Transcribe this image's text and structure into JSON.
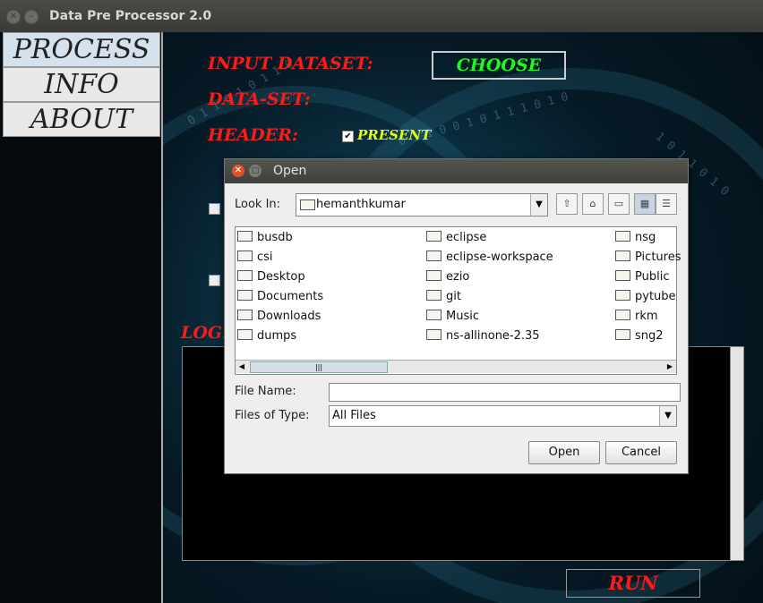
{
  "window": {
    "title": "Data Pre Processor 2.0"
  },
  "tabs": [
    {
      "label": "PROCESS"
    },
    {
      "label": "INFO"
    },
    {
      "label": "ABOUT"
    }
  ],
  "form": {
    "input_dataset_label": "INPUT DATASET:",
    "choose_label": "CHOOSE",
    "dataset_label": "DATA-SET:",
    "header_label": "HEADER:",
    "present_label": "PRESENT",
    "present_checked": true,
    "log_label": "LOG.",
    "run_label": "RUN"
  },
  "dialog": {
    "title": "Open",
    "look_in_label": "Look In:",
    "look_in_value": "hemanthkumar",
    "files": [
      "busdb",
      "csi",
      "Desktop",
      "Documents",
      "Downloads",
      "dumps",
      "eclipse",
      "eclipse-workspace",
      "ezio",
      "git",
      "Music",
      "ns-allinone-2.35",
      "nsg",
      "Pictures",
      "Public",
      "pytube",
      "rkm",
      "sng2"
    ],
    "file_name_label": "File Name:",
    "file_name_value": "",
    "files_of_type_label": "Files of Type:",
    "files_of_type_value": "All Files",
    "open_button": "Open",
    "cancel_button": "Cancel"
  },
  "colors": {
    "label_red": "#ff1a1a",
    "choose_green": "#1aff1a",
    "present_yellow": "#e8ff00"
  }
}
